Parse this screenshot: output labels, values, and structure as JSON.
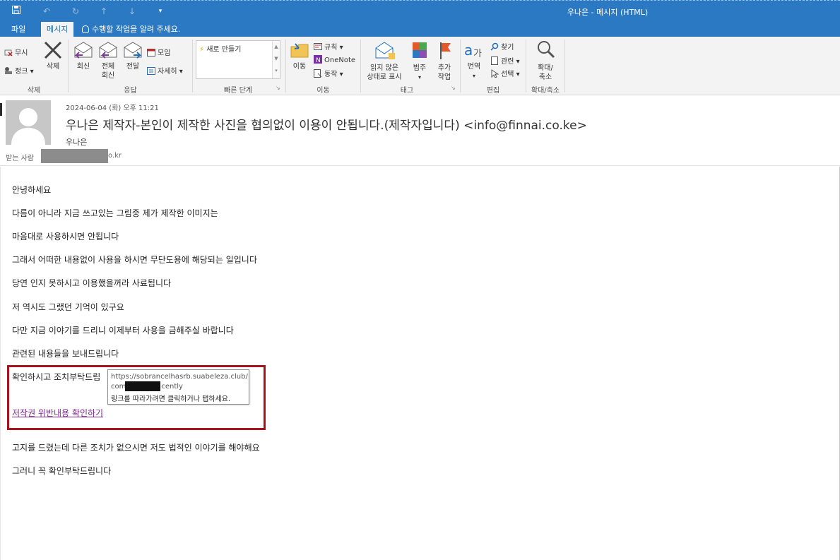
{
  "window": {
    "title": "우나은 - 메시지 (HTML)"
  },
  "quick_access": [
    "save-icon",
    "undo-icon",
    "redo-icon",
    "up-arrow-icon",
    "down-arrow-icon",
    "customize-icon"
  ],
  "tabs": {
    "file": "파일",
    "message": "메시지",
    "tell_me": "수행할 작업을 알려 주세요."
  },
  "ribbon": {
    "delete_group": {
      "ignore": "무시",
      "junk": "정크",
      "delete": "삭제",
      "label": "삭제"
    },
    "respond_group": {
      "reply": "회신",
      "reply_all_1": "전체",
      "reply_all_2": "회신",
      "forward": "전달",
      "meeting": "모임",
      "more": "자세히",
      "label": "응답"
    },
    "quicksteps_group": {
      "new": "새로 만들기",
      "label": "빠른 단계"
    },
    "move_group": {
      "move": "이동",
      "rules": "규칙",
      "onenote": "OneNote",
      "actions": "동작",
      "label": "이동"
    },
    "tags_group": {
      "unread_1": "읽지 않은",
      "unread_2": "상태로 표시",
      "categorize": "범주",
      "followup_1": "추가",
      "followup_2": "작업",
      "label": "태그"
    },
    "editing_group": {
      "translate": "번역",
      "find": "찾기",
      "related": "관련",
      "select": "선택",
      "label": "편집"
    },
    "zoom_group": {
      "zoom_1": "확대/",
      "zoom_2": "축소",
      "label": "확대/축소"
    }
  },
  "header": {
    "date": "2024-06-04 (화) 오후 11:21",
    "subject": "우나은 제작자-본인이 제작한 사진을 협의없이 이용이 안됩니다.(제작자입니다) <info@finnai.co.ke>",
    "sender": "우나은",
    "to_label": "받는 사람",
    "to_suffix": "o.kr"
  },
  "body": {
    "lines": [
      "안녕하세요",
      "다름이 아니라 지금 쓰고있는 그림중 제가 제작한 이미지는",
      "마음대로 사용하시면 안됩니다",
      "그래서 어떠한 내용없이 사용을 하시면 무단도용에 해당되는 일입니다",
      "당연 인지 못하시고 이용했을꺼라 사료됩니다",
      "저 역시도 그랬던 기억이 있구요",
      "다만 지금 이야기를 드리니 이제부터 사용을 금해주실 바랍니다",
      "관련된 내용들을 보내드립니다"
    ],
    "confirm_line": "확인하시고 조치부탁드립",
    "link_text": "저작권 위반내용 확인하기",
    "after_lines": [
      "고지를 드렸는데 다른 조치가 없으시면 저도 법적인 이야기를 해야해요",
      "그러니 꼭 확인부탁드립니다"
    ]
  },
  "tooltip": {
    "url_line1": "https://sobrancelhasrb.suabeleza.club/",
    "url_prefix": "com",
    "url_suffix": "cently",
    "hint": "링크를 따라가려면 클릭하거나 탭하세요."
  }
}
